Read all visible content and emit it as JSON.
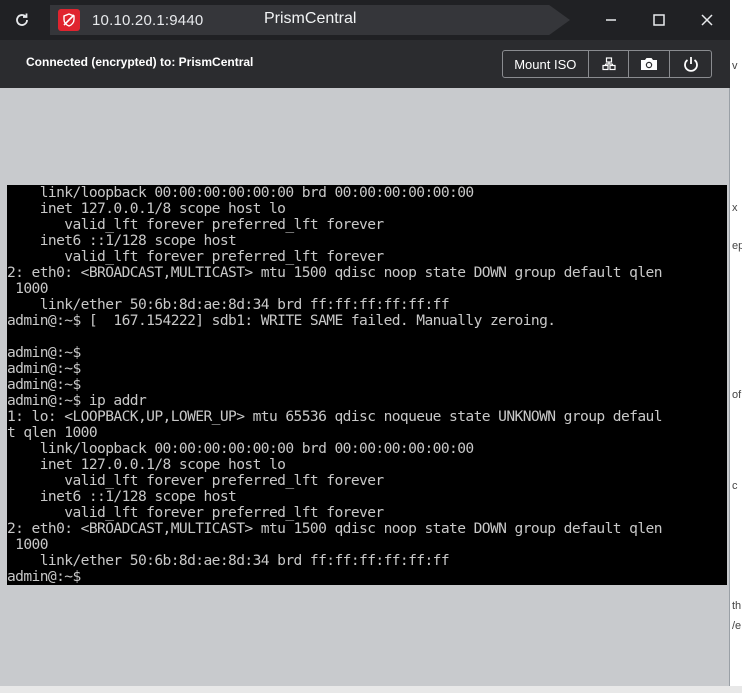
{
  "titlebar": {
    "url": "10.10.20.1:9440",
    "page_title": "PrismCentral"
  },
  "toolbar": {
    "status": "Connected (encrypted) to: PrismCentral",
    "mount_iso_label": "Mount ISO"
  },
  "console": {
    "lines": [
      "    link/loopback 00:00:00:00:00:00 brd 00:00:00:00:00:00",
      "    inet 127.0.0.1/8 scope host lo",
      "       valid_lft forever preferred_lft forever",
      "    inet6 ::1/128 scope host",
      "       valid_lft forever preferred_lft forever",
      "2: eth0: <BROADCAST,MULTICAST> mtu 1500 qdisc noop state DOWN group default qlen",
      " 1000",
      "    link/ether 50:6b:8d:ae:8d:34 brd ff:ff:ff:ff:ff:ff",
      "admin@:~$ [  167.154222] sdb1: WRITE SAME failed. Manually zeroing.",
      "",
      "admin@:~$",
      "admin@:~$",
      "admin@:~$",
      "admin@:~$ ip addr",
      "1: lo: <LOOPBACK,UP,LOWER_UP> mtu 65536 qdisc noqueue state UNKNOWN group defaul",
      "t qlen 1000",
      "    link/loopback 00:00:00:00:00:00 brd 00:00:00:00:00:00",
      "    inet 127.0.0.1/8 scope host lo",
      "       valid_lft forever preferred_lft forever",
      "    inet6 ::1/128 scope host",
      "       valid_lft forever preferred_lft forever",
      "2: eth0: <BROADCAST,MULTICAST> mtu 1500 qdisc noop state DOWN group default qlen",
      " 1000",
      "    link/ether 50:6b:8d:ae:8d:34 brd ff:ff:ff:ff:ff:ff",
      "admin@:~$"
    ]
  },
  "background_fragments": {
    "f1": "v",
    "f2": "x",
    "f3": "ep",
    "f4": "of",
    "f5": "c",
    "f6": "th",
    "f7": "/e"
  },
  "icons": [
    "reload-icon",
    "not-secure-shield-icon",
    "minimize-icon",
    "maximize-icon",
    "close-icon",
    "keyboard-layout-icon",
    "camera-icon",
    "power-icon"
  ],
  "colors": {
    "titlebar_bg": "#202124",
    "toolbar_bg": "#2b2c2f",
    "console_bg": "#000000",
    "console_fg": "#c8c8c8",
    "insecure_badge": "#e0242f"
  }
}
